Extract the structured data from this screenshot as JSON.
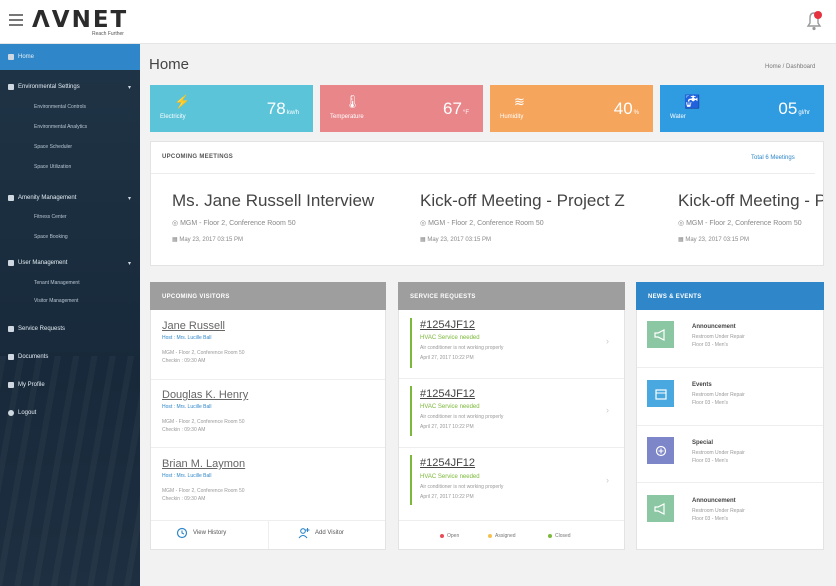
{
  "app": {
    "brand": "ΛVNET",
    "tagline": "Reach Further"
  },
  "sidebar": {
    "items": [
      {
        "label": "Home",
        "icon": "home-icon"
      },
      {
        "label": "Environmental Settings",
        "icon": "sliders-icon",
        "children": [
          "Environmental Controls",
          "Environmental Analytics",
          "Space Scheduler",
          "Space Utilization"
        ]
      },
      {
        "label": "Amenity Management",
        "icon": "building-icon",
        "children": [
          "Fitness Center",
          "Space Booking"
        ]
      },
      {
        "label": "User Management",
        "icon": "user-group-icon",
        "children": [
          "Tenant Management",
          "Visitor Management"
        ]
      },
      {
        "label": "Service Requests",
        "icon": "clipboard-icon"
      },
      {
        "label": "Documents",
        "icon": "document-icon"
      },
      {
        "label": "My Profile",
        "icon": "person-icon"
      },
      {
        "label": "Logout",
        "icon": "power-icon"
      }
    ]
  },
  "page": {
    "title": "Home",
    "breadcrumb": "Home / Dashboard"
  },
  "stats": [
    {
      "label": "Electricity",
      "value": "78",
      "unit": "kw/h",
      "color": "#5bc4d8"
    },
    {
      "label": "Temperature",
      "value": "67",
      "unit": "°F",
      "color": "#e8868a"
    },
    {
      "label": "Humidity",
      "value": "40",
      "unit": "%",
      "color": "#f6a55c"
    },
    {
      "label": "Water",
      "value": "05",
      "unit": "gl/hr",
      "color": "#2f9be0"
    }
  ],
  "meetings": {
    "title": "UPCOMING MEETINGS",
    "total_link": "Total 6 Meetings",
    "items": [
      {
        "title": "Ms. Jane Russell Interview",
        "location": "MGM - Floor 2, Conference Room 50",
        "datetime": "May 23, 2017  03:15 PM"
      },
      {
        "title": "Kick-off Meeting - Project Z",
        "location": "MGM - Floor 2, Conference Room 50",
        "datetime": "May 23, 2017  03:15 PM"
      },
      {
        "title": "Kick-off Meeting - Project Z",
        "location": "MGM - Floor 2, Conference Room 50",
        "datetime": "May 23, 2017  03:15 PM"
      }
    ]
  },
  "visitors": {
    "title": "UPCOMING VISITORS",
    "items": [
      {
        "name": "Jane Russell",
        "host": "Host : Mrs. Lucille Ball",
        "location": "MGM - Floor 2, Conference Room 50",
        "checkin": "Checkin : 09:30 AM"
      },
      {
        "name": "Douglas K. Henry",
        "host": "Host : Mrs. Lucille Ball",
        "location": "MGM - Floor 2, Conference Room 50",
        "checkin": "Checkin : 09:30 AM"
      },
      {
        "name": "Brian M. Laymon",
        "host": "Host : Mrs. Lucille Ball",
        "location": "MGM - Floor 2, Conference Room 50",
        "checkin": "Checkin : 09:30 AM"
      }
    ],
    "view_history": "View History",
    "add_visitor": "Add Visitor"
  },
  "service_requests": {
    "title": "SERVICE REQUESTS",
    "items": [
      {
        "id": "#1254JF12",
        "type": "HVAC Service needed",
        "desc": "Air conditioner is not working properly",
        "date": "April 27, 2017  10:22 PM"
      },
      {
        "id": "#1254JF12",
        "type": "HVAC Service needed",
        "desc": "Air conditioner is not working properly",
        "date": "April 27, 2017  10:22 PM"
      },
      {
        "id": "#1254JF12",
        "type": "HVAC Service needed",
        "desc": "Air conditioner is not working properly",
        "date": "April 27, 2017  10:22 PM"
      }
    ],
    "legend": [
      {
        "label": "Open",
        "color": "#e84c5c"
      },
      {
        "label": "Assigned",
        "color": "#f2c14e"
      },
      {
        "label": "Closed",
        "color": "#7bb93a"
      }
    ]
  },
  "news": {
    "title": "NEWS & EVENTS",
    "items": [
      {
        "title": "Announcement",
        "sub1": "Restroom Under Repair",
        "sub2": "Floor 03 - Men's",
        "color": "#8cc7a4",
        "icon": "megaphone-icon"
      },
      {
        "title": "Events",
        "sub1": "Restroom Under Repair",
        "sub2": "Floor 03 - Men's",
        "color": "#4aa8e0",
        "icon": "calendar-icon"
      },
      {
        "title": "Special",
        "sub1": "Restroom Under Repair",
        "sub2": "Floor 03 - Men's",
        "color": "#7d86c8",
        "icon": "star-icon"
      },
      {
        "title": "Announcement",
        "sub1": "Restroom Under Repair",
        "sub2": "Floor 03 - Men's",
        "color": "#8cc7a4",
        "icon": "megaphone-icon"
      }
    ]
  },
  "colors": {
    "sidebar": "#1f3446",
    "accent": "#2f87c9",
    "panel_grey": "#9e9e9e",
    "news_blue": "#2f87c9"
  }
}
